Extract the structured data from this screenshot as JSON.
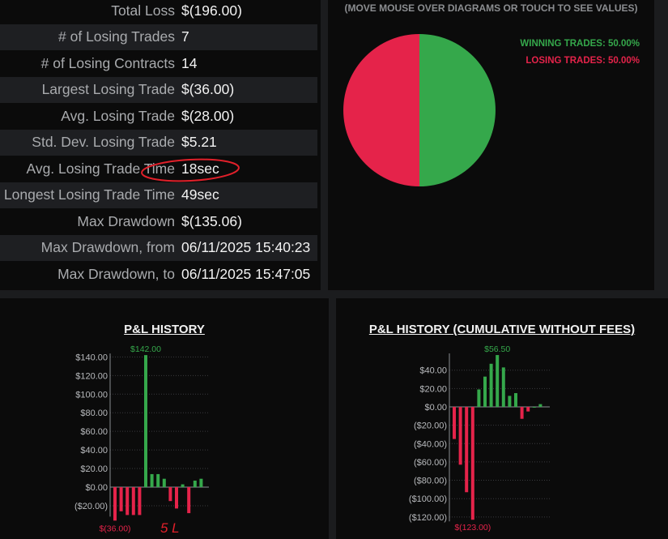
{
  "stats": [
    {
      "label": "Total Loss",
      "value": "$(196.00)"
    },
    {
      "label": "# of Losing Trades",
      "value": "7"
    },
    {
      "label": "# of Losing Contracts",
      "value": "14"
    },
    {
      "label": "Largest Losing Trade",
      "value": "$(36.00)"
    },
    {
      "label": "Avg. Losing Trade",
      "value": "$(28.00)"
    },
    {
      "label": "Std. Dev. Losing Trade",
      "value": "$5.21"
    },
    {
      "label": "Avg. Losing Trade Time",
      "value": "18sec"
    },
    {
      "label": "Longest Losing Trade Time",
      "value": "49sec"
    },
    {
      "label": "Max Drawdown",
      "value": "$(135.06)"
    },
    {
      "label": "Max Drawdown, from",
      "value": "06/11/2025 15:40:23"
    },
    {
      "label": "Max Drawdown, to",
      "value": "06/11/2025 15:47:05"
    }
  ],
  "pie": {
    "header": "(MOVE MOUSE OVER DIAGRAMS OR TOUCH TO SEE VALUES)",
    "winning_label": "WINNING TRADES: 50.00%",
    "losing_label": "LOSING TRADES: 50.00%",
    "win_color": "#35a84b",
    "loss_color": "#e5234a"
  },
  "annotations": {
    "handwritten_text": "5 L"
  },
  "chart_data": [
    {
      "type": "bar",
      "title": "P&L HISTORY",
      "ylim": [
        -30,
        142
      ],
      "yticks": [
        140,
        120,
        100,
        80,
        60,
        40,
        20,
        0,
        -20
      ],
      "ytick_labels": [
        "$140.00",
        "$120.00",
        "$100.00",
        "$80.00",
        "$60.00",
        "$40.00",
        "$20.00",
        "$0.00",
        "($20.00)"
      ],
      "values": [
        -36,
        -26,
        -30,
        -30,
        -30,
        142,
        14,
        14,
        9,
        -15,
        -23,
        3,
        -28,
        7,
        9
      ],
      "max_label": "$142.00",
      "min_label": "$(36.00)",
      "grid": true,
      "colors": {
        "positive": "#35a84b",
        "negative": "#e5234a"
      }
    },
    {
      "type": "bar",
      "title": "P&L HISTORY (CUMULATIVE WITHOUT FEES)",
      "ylim": [
        -123,
        56.5
      ],
      "yticks": [
        40,
        20,
        0,
        -20,
        -40,
        -60,
        -80,
        -100,
        -120
      ],
      "ytick_labels": [
        "$40.00",
        "$20.00",
        "$0.00",
        "($20.00)",
        "($40.00)",
        "($60.00)",
        "($80.00)",
        "($100.00)",
        "($120.00)"
      ],
      "values": [
        -35,
        -63,
        -93,
        -123,
        19,
        33,
        47,
        56.5,
        43,
        12,
        15,
        -13,
        -5,
        0,
        3
      ],
      "max_label": "$56.50",
      "min_label": "$(123.00)",
      "grid": true,
      "colors": {
        "positive": "#35a84b",
        "negative": "#e5234a"
      }
    }
  ]
}
